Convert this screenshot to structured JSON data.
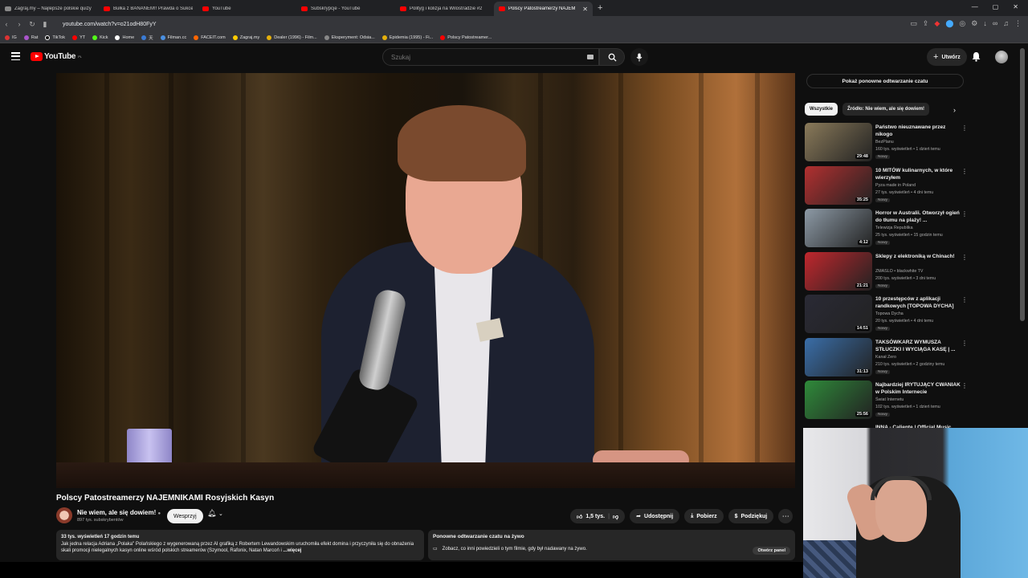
{
  "browser": {
    "tabs": [
      {
        "label": "Zagraj.my – Najlepsze polskie quizy",
        "active": false
      },
      {
        "label": "Bułka z BANANEM!! Prawda o Sukces",
        "active": false
      },
      {
        "label": "YouTube",
        "active": false
      },
      {
        "label": "Subskrypcje - YouTube",
        "active": false
      },
      {
        "label": "Polityg i kolizja na Wilostradzie #2",
        "active": false
      },
      {
        "label": "Polscy Patostreamerzy NAJEM",
        "active": true
      }
    ],
    "url": "youtube.com/watch?v=o21odH80FyY",
    "bookmarks": [
      "IG",
      "Rat",
      "TikTok",
      "YT",
      "Kick",
      "Home",
      "天",
      "Filman.cc",
      "FACEIT.com",
      "Zagraj.my",
      "Dealer (1996) - Film...",
      "Eksperyment: Odsia...",
      "Epidemia (1995) - Fi...",
      "Polscy Patostreamer..."
    ]
  },
  "header": {
    "logo_text": "YouTube",
    "logo_region": "PL",
    "search_placeholder": "Szukaj",
    "create_label": "Utwórz"
  },
  "video": {
    "title": "Polscy Patostreamerzy NAJEMNIKAMI Rosyjskich Kasyn",
    "channel": "Nie wiem, ale się dowiem!",
    "subscribers": "897 tys. subskrybentów",
    "support_label": "Wesprzyj",
    "likes": "1,5 tys.",
    "share_label": "Udostępnij",
    "download_label": "Pobierz",
    "thanks_label": "Podziękuj",
    "description": {
      "stats": "33 tys. wyświetleń  17 godzin temu",
      "text": "Jak jedna relacja Adriana „Polaka\" Polańskiego z wygenerowaną przez AI grafiką z Robertem Lewandowskim uruchomiła efekt domina i przyczyniła się do obnażenia skali promocji nielegalnych kasyn online wśród polskich streamerów (Szymool, Rafonix, Natan Marcoń i",
      "more": "...więcej"
    },
    "live_chat": {
      "title": "Ponowne odtwarzanie czatu na żywo",
      "text": "Zobacz, co inni powiedzieli o tym filmie, gdy był nadawany na żywo.",
      "button": "Otwórz panel"
    }
  },
  "sidebar": {
    "replay_chat": "Pokaż ponowne odtwarzanie czatu",
    "chips": [
      "Wszystkie",
      "Źródło: Nie wiem, ale się dowiem!"
    ],
    "recommendations": [
      {
        "title": "Państwo nieuznawane przez nikogo",
        "channel": "BezPlanu",
        "meta": "160 tys. wyświetleń • 1 dzień temu",
        "badge": "Nowy",
        "duration": "29:48",
        "thumb": "#8a7a5a"
      },
      {
        "title": "10 MITÓW kulinarnych, w które wierzyłem",
        "channel": "Pyza made in Poland",
        "meta": "27 tys. wyświetleń • 4 dni temu",
        "badge": "Nowy",
        "duration": "35:25",
        "thumb": "#b23030"
      },
      {
        "title": "Horror w Australii. Otworzył ogień do tłumu na plaży! ...",
        "channel": "Telewizja Republika",
        "meta": "25 tys. wyświetleń • 15 godzin temu",
        "badge": "Nowy",
        "duration": "4:12",
        "thumb": "#8d9aa6"
      },
      {
        "title": "Sklepy z elektroniką w Chinach!",
        "channel": "ZMASLO • blackwhite TV",
        "meta": "200 tys. wyświetleń • 3 dni temu",
        "badge": "Nowy",
        "duration": "21:21",
        "thumb": "#c0272d"
      },
      {
        "title": "10 przestępców z aplikacji randkowych [TOPOWA DYCHA]",
        "channel": "Topowa Dycha",
        "meta": "20 tys. wyświetleń • 4 dni temu",
        "badge": "Nowy",
        "duration": "14:51",
        "thumb": "#2a2a35"
      },
      {
        "title": "TAKSÓWKARZ WYMUSZA STŁUCZKI I WYCIĄGA KASĘ | ...",
        "channel": "Kanał Zero",
        "meta": "210 tys. wyświetleń • 2 godziny temu",
        "badge": "Nowy",
        "duration": "31:13",
        "thumb": "#3a6ea8"
      },
      {
        "title": "Najbardziej IRYTUJĄCY CWANIAK w Polskim Internecie",
        "channel": "Świat Internetu",
        "meta": "102 tys. wyświetleń • 1 dzień temu",
        "badge": "Nowy",
        "duration": "25:56",
        "thumb": "#2f8a3a"
      }
    ],
    "partial_title": "INNA - Caliente | Official Music"
  },
  "colors": {
    "accent": "#ff0000",
    "bg": "#0f0f0f",
    "chip": "#272727"
  }
}
